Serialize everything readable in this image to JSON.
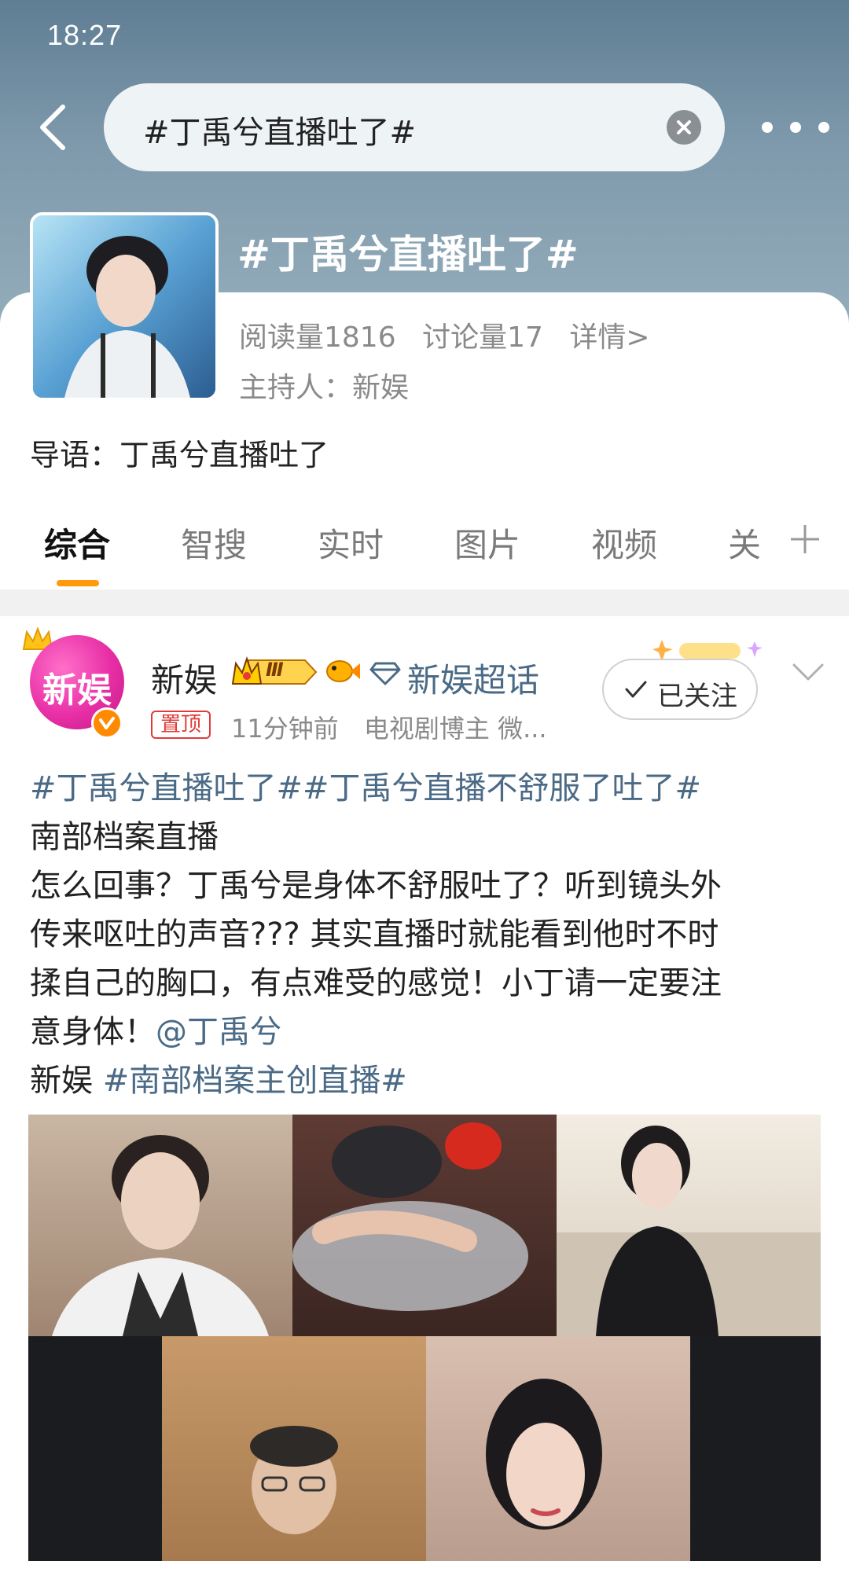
{
  "status_bar": {
    "time": "18:27"
  },
  "search": {
    "query": "#丁禹兮直播吐了#"
  },
  "topic": {
    "title": "#丁禹兮直播吐了#",
    "reads": "阅读量1816",
    "discussions": "讨论量17",
    "details_link": "详情>",
    "host": "主持人：新娱",
    "intro": "导语：丁禹兮直播吐了"
  },
  "tabs": [
    {
      "label": "综合",
      "active": true
    },
    {
      "label": "智搜"
    },
    {
      "label": "实时"
    },
    {
      "label": "图片"
    },
    {
      "label": "视频"
    },
    {
      "label": "关"
    }
  ],
  "post": {
    "avatar_text": "新娱",
    "author": "新娱",
    "level": "Ⅲ",
    "super_topic": "新娱超话",
    "pinned": "置顶",
    "time": "11分钟前",
    "role": "电视剧博主 微...",
    "follow_label": "已关注",
    "lines": [
      {
        "hashtags": "#丁禹兮直播吐了##丁禹兮直播不舒服了吐了#"
      },
      {
        "text": "南部档案直播"
      },
      {
        "text": "怎么回事？丁禹兮是身体不舒服吐了？听到镜头外"
      },
      {
        "text": "传来呕吐的声音??? 其实直播时就能看到他时不时"
      },
      {
        "text": "揉自己的胸口，有点难受的感觉！小丁请一定要注"
      },
      {
        "text": "意身体！",
        "mention": "@丁禹兮"
      },
      {
        "text": "新娱 ",
        "hashtag": "#南部档案主创直播#"
      }
    ]
  },
  "colors": {
    "accent": "#ff9a0a",
    "link": "#4a6a86",
    "pin": "#e03b3b"
  }
}
